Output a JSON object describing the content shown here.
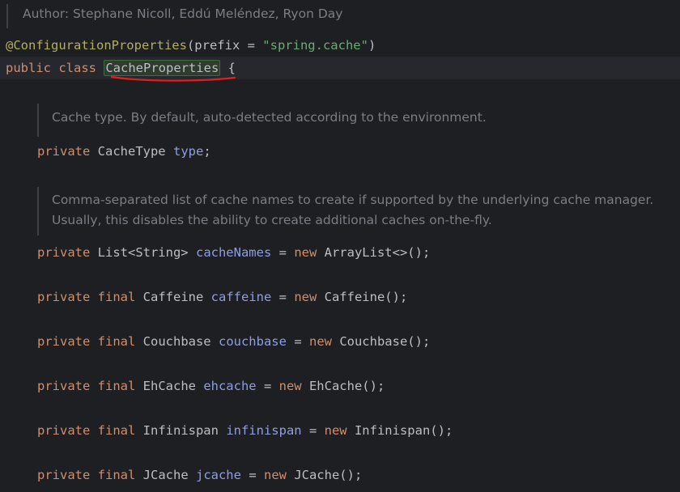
{
  "editor": {
    "author_doc": "Author: Stephane Nicoll, Eddú Meléndez, Ryon Day",
    "annotation": "@ConfigurationProperties",
    "annotation_args_open": "(prefix = ",
    "annotation_string": "\"spring.cache\"",
    "annotation_args_close": ")",
    "class_kw": "public class ",
    "class_name": "CacheProperties",
    "class_brace": " {",
    "doc_type": "Cache type. By default, auto-detected according to the environment.",
    "doc_names_1": "Comma-separated list of cache names to create if supported by the underlying cache manager.",
    "doc_names_2": "Usually, this disables the ability to create additional caches on-the-fly.",
    "fields": [
      {
        "mods": "private ",
        "type": "CacheType ",
        "name": "type",
        "init": ";"
      },
      {
        "mods": "private ",
        "type": "List<String> ",
        "name": "cacheNames",
        "eq": " = ",
        "newkw": "new ",
        "ctor": "ArrayList<>();"
      },
      {
        "mods": "private final ",
        "type": "Caffeine ",
        "name": "caffeine",
        "eq": " = ",
        "newkw": "new ",
        "ctor": "Caffeine();"
      },
      {
        "mods": "private final ",
        "type": "Couchbase ",
        "name": "couchbase",
        "eq": " = ",
        "newkw": "new ",
        "ctor": "Couchbase();"
      },
      {
        "mods": "private final ",
        "type": "EhCache ",
        "name": "ehcache",
        "eq": " = ",
        "newkw": "new ",
        "ctor": "EhCache();"
      },
      {
        "mods": "private final ",
        "type": "Infinispan ",
        "name": "infinispan",
        "eq": " = ",
        "newkw": "new ",
        "ctor": "Infinispan();"
      },
      {
        "mods": "private final ",
        "type": "JCache ",
        "name": "jcache",
        "eq": " = ",
        "newkw": "new ",
        "ctor": "JCache();"
      }
    ],
    "colors": {
      "background": "#1e1f22",
      "keyword": "#cf8e6d",
      "annotation": "#b3ae60",
      "string": "#6aab73",
      "field": "#8f9ee0",
      "doc": "#7a7e85",
      "squiggle": "#e0201f"
    }
  }
}
